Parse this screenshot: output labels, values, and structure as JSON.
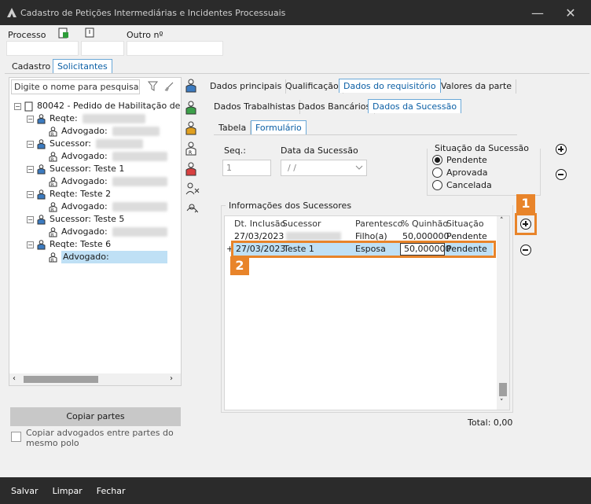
{
  "window": {
    "title": "Cadastro de Petições Intermediárias e Incidentes Processuais"
  },
  "header": {
    "processo_label": "Processo",
    "outro_label": "Outro nº"
  },
  "main_tabs": [
    "Cadastro",
    "Solicitantes"
  ],
  "left": {
    "search_placeholder": "Digite o nome para pesquisa...",
    "root_label": "80042 - Pedido de Habilitação de",
    "nodes": [
      {
        "label": "Reqte:",
        "child": "Advogado:"
      },
      {
        "label": "Sucessor:",
        "child": "Advogado:"
      },
      {
        "label": "Sucessor: Teste 1",
        "child": "Advogado:"
      },
      {
        "label": "Reqte: Teste 2",
        "child": "Advogado:"
      },
      {
        "label": "Sucessor: Teste 5",
        "child": "Advogado:"
      },
      {
        "label": "Reqte: Teste 6",
        "child": "Advogado:"
      }
    ],
    "copy_button": "Copiar partes",
    "copy_checkbox": "Copiar advogados entre partes do mesmo polo"
  },
  "right_tabs_l1": [
    "Dados principais",
    "Qualificação",
    "Dados do requisitório",
    "Valores da parte"
  ],
  "right_tabs_l2": [
    "Dados Trabalhistas",
    "Dados Bancários",
    "Dados da Sucessão"
  ],
  "right_tabs_l3": [
    "Tabela",
    "Formulário"
  ],
  "form": {
    "seq_label": "Seq.:",
    "seq_value": "1",
    "data_label": "Data da Sucessão",
    "data_value": "/ /",
    "situacao_label": "Situação da Sucessão",
    "situacao_options": [
      "Pendente",
      "Aprovada",
      "Cancelada"
    ],
    "situacao_selected": "Pendente"
  },
  "grid": {
    "group_label": "Informações dos Sucessores",
    "columns": [
      "Dt. Inclusão",
      "Sucessor",
      "Parentesco",
      "% Quinhão",
      "Situação"
    ],
    "rows": [
      {
        "date": "27/03/2023",
        "sucessor": "",
        "parentesco": "Filho(a)",
        "quinhao": "50,000000",
        "situacao": "Pendente"
      },
      {
        "date": "27/03/2023",
        "sucessor": "Teste 1",
        "parentesco": "Esposa",
        "quinhao": "50,000000",
        "situacao": "Pendente"
      }
    ],
    "total": "Total: 0,00",
    "row_marker": "+"
  },
  "callouts": [
    "1",
    "2"
  ],
  "footer": [
    "Salvar",
    "Limpar",
    "Fechar"
  ],
  "colors": {
    "selection": "#bfe0f5",
    "callout": "#e8842a",
    "titlebar": "#2b2b2b"
  }
}
